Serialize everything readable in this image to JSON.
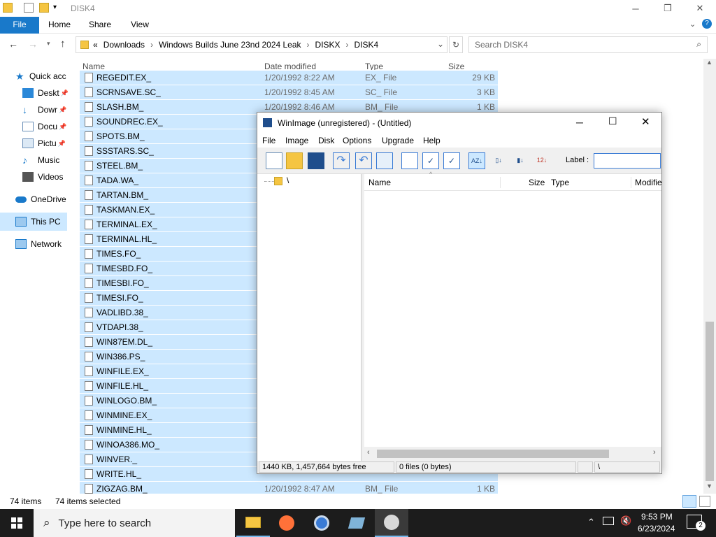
{
  "window": {
    "title": "DISK4"
  },
  "ribbon": {
    "tabs": [
      "File",
      "Home",
      "Share",
      "View"
    ]
  },
  "address": {
    "crumbs_prefix": "«",
    "crumbs": [
      "Downloads",
      "Windows Builds June 23nd 2024 Leak",
      "DISKX",
      "DISK4"
    ],
    "search_placeholder": "Search DISK4"
  },
  "nav": [
    {
      "label": "Quick acc"
    },
    {
      "label": "Deskt"
    },
    {
      "label": "Dowr"
    },
    {
      "label": "Docu"
    },
    {
      "label": "Pictu"
    },
    {
      "label": "Music"
    },
    {
      "label": "Videos"
    },
    {
      "label": "OneDrive"
    },
    {
      "label": "This PC"
    },
    {
      "label": "Network"
    }
  ],
  "columns": {
    "name": "Name",
    "date": "Date modified",
    "type": "Type",
    "size": "Size"
  },
  "files": [
    {
      "name": "REGEDIT.EX_",
      "date": "1/20/1992 8:22 AM",
      "type": "EX_ File",
      "size": "29 KB"
    },
    {
      "name": "SCRNSAVE.SC_",
      "date": "1/20/1992 8:45 AM",
      "type": "SC_ File",
      "size": "3 KB"
    },
    {
      "name": "SLASH.BM_",
      "date": "1/20/1992 8:46 AM",
      "type": "BM_ File",
      "size": "1 KB"
    },
    {
      "name": "SOUNDREC.EX_",
      "date": "",
      "type": "",
      "size": ""
    },
    {
      "name": "SPOTS.BM_",
      "date": "",
      "type": "",
      "size": ""
    },
    {
      "name": "SSSTARS.SC_",
      "date": "",
      "type": "",
      "size": ""
    },
    {
      "name": "STEEL.BM_",
      "date": "",
      "type": "",
      "size": ""
    },
    {
      "name": "TADA.WA_",
      "date": "",
      "type": "",
      "size": ""
    },
    {
      "name": "TARTAN.BM_",
      "date": "",
      "type": "",
      "size": ""
    },
    {
      "name": "TASKMAN.EX_",
      "date": "",
      "type": "",
      "size": ""
    },
    {
      "name": "TERMINAL.EX_",
      "date": "",
      "type": "",
      "size": ""
    },
    {
      "name": "TERMINAL.HL_",
      "date": "",
      "type": "",
      "size": ""
    },
    {
      "name": "TIMES.FO_",
      "date": "",
      "type": "",
      "size": ""
    },
    {
      "name": "TIMESBD.FO_",
      "date": "",
      "type": "",
      "size": ""
    },
    {
      "name": "TIMESBI.FO_",
      "date": "",
      "type": "",
      "size": ""
    },
    {
      "name": "TIMESI.FO_",
      "date": "",
      "type": "",
      "size": ""
    },
    {
      "name": "VADLIBD.38_",
      "date": "",
      "type": "",
      "size": ""
    },
    {
      "name": "VTDAPI.38_",
      "date": "",
      "type": "",
      "size": ""
    },
    {
      "name": "WIN87EM.DL_",
      "date": "",
      "type": "",
      "size": ""
    },
    {
      "name": "WIN386.PS_",
      "date": "",
      "type": "",
      "size": ""
    },
    {
      "name": "WINFILE.EX_",
      "date": "",
      "type": "",
      "size": ""
    },
    {
      "name": "WINFILE.HL_",
      "date": "",
      "type": "",
      "size": ""
    },
    {
      "name": "WINLOGO.BM_",
      "date": "",
      "type": "",
      "size": ""
    },
    {
      "name": "WINMINE.EX_",
      "date": "",
      "type": "",
      "size": ""
    },
    {
      "name": "WINMINE.HL_",
      "date": "",
      "type": "",
      "size": ""
    },
    {
      "name": "WINOA386.MO_",
      "date": "",
      "type": "",
      "size": ""
    },
    {
      "name": "WINVER._",
      "date": "",
      "type": "",
      "size": ""
    },
    {
      "name": "WRITE.HL_",
      "date": "",
      "type": "",
      "size": ""
    },
    {
      "name": "ZIGZAG.BM_",
      "date": "1/20/1992 8:47 AM",
      "type": "BM_ File",
      "size": "1 KB"
    }
  ],
  "status": {
    "items": "74 items",
    "selected": "74 items selected"
  },
  "taskbar": {
    "search_placeholder": "Type here to search",
    "time": "9:53 PM",
    "date": "6/23/2024",
    "notifications": "2"
  },
  "winimage": {
    "title": "WinImage (unregistered) - (Untitled)",
    "menu": [
      "File",
      "Image",
      "Disk",
      "Options",
      "Upgrade",
      "Help"
    ],
    "label_text": "Label :",
    "label_value": "",
    "tree_root": "\\",
    "columns": {
      "name": "Name",
      "size": "Size",
      "type": "Type",
      "modified": "Modifie"
    },
    "status_free": "1440 KB, 1,457,664 bytes free",
    "status_files": "0 files (0 bytes)",
    "status_path": "\\"
  }
}
